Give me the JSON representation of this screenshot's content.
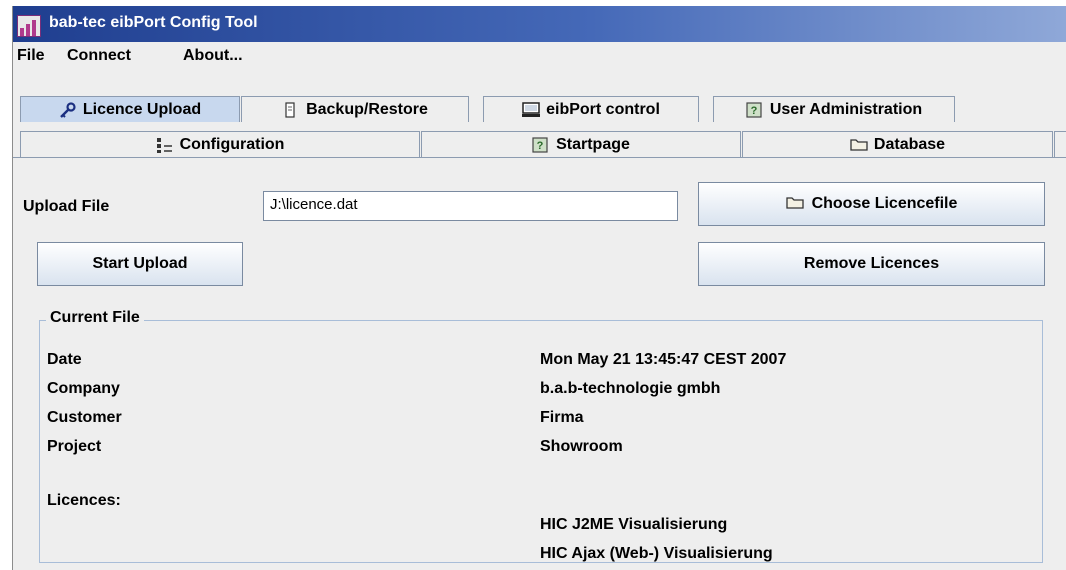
{
  "window": {
    "title": "bab-tec eibPort Config Tool"
  },
  "menu": {
    "file": "File",
    "connect": "Connect",
    "about": "About..."
  },
  "tabs": {
    "row1": [
      {
        "label": "Licence Upload",
        "icon": "key-icon"
      },
      {
        "label": "Backup/Restore",
        "icon": "document-icon"
      },
      {
        "label": "eibPort control",
        "icon": "monitor-icon"
      },
      {
        "label": "User Administration",
        "icon": "placeholder-icon"
      }
    ],
    "row2": [
      {
        "label": "Configuration",
        "icon": "tree-icon"
      },
      {
        "label": "Startpage",
        "icon": "placeholder-icon"
      },
      {
        "label": "Database",
        "icon": "folder-icon"
      }
    ]
  },
  "upload": {
    "file_label": "Upload File",
    "file_value": "J:\\licence.dat",
    "choose_button": "Choose Licencefile",
    "start_button": "Start Upload",
    "remove_button": "Remove Licences"
  },
  "current_file": {
    "legend": "Current File",
    "date_label": "Date",
    "date_value": "Mon May 21 13:45:47 CEST 2007",
    "company_label": "Company",
    "company_value": "b.a.b-technologie gmbh",
    "customer_label": "Customer",
    "customer_value": "Firma",
    "project_label": "Project",
    "project_value": "Showroom",
    "licences_label": "Licences:",
    "licences": [
      "HIC J2ME Visualisierung",
      "HIC Ajax (Web-) Visualisierung"
    ]
  }
}
